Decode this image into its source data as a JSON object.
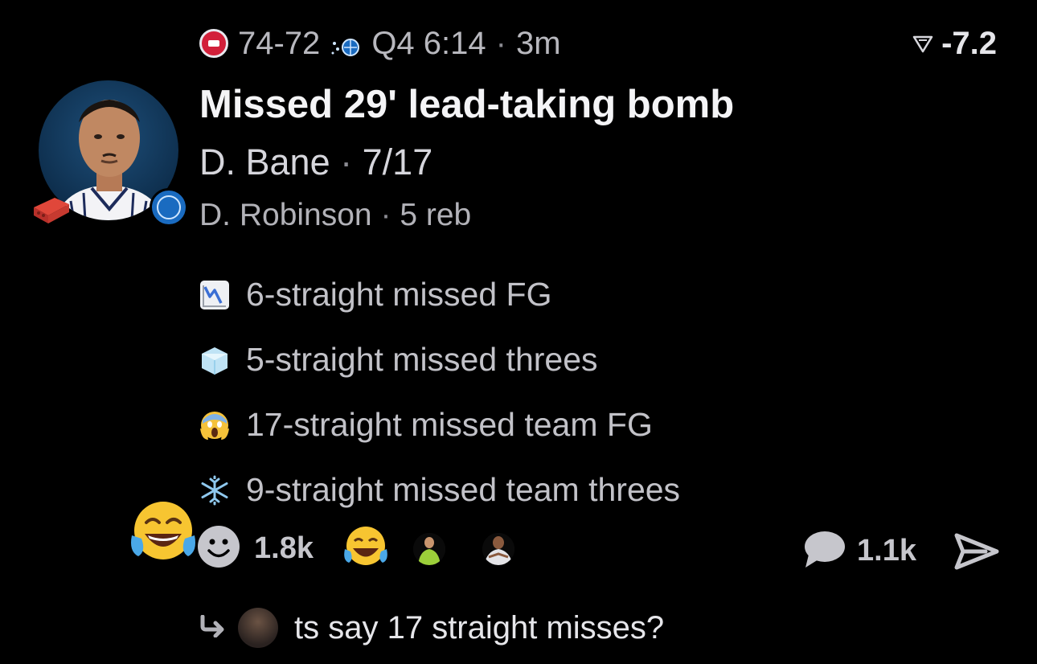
{
  "header": {
    "home_logo_icon": "pistons-logo",
    "score": "74-72",
    "away_logo_icon": "magic-logo",
    "game_clock": "Q4 6:14",
    "separator": "·",
    "age": "3m",
    "line_icon": "triangle-down-icon",
    "line_value": "-7.2"
  },
  "play": {
    "title": "Missed 29' lead-taking bomb",
    "player": "D. Bane",
    "player_stat": "7/17",
    "secondary_player": "D. Robinson",
    "secondary_stat": "5 reb",
    "separator": "·"
  },
  "stats": [
    {
      "icon": "chart-decreasing-icon",
      "text": "6-straight missed FG"
    },
    {
      "icon": "ice-cube-icon",
      "text": "5-straight missed threes"
    },
    {
      "icon": "screaming-face-icon",
      "text": "17-straight missed team FG"
    },
    {
      "icon": "snowflake-icon",
      "text": "9-straight missed team threes"
    }
  ],
  "reactions": {
    "user_reaction_icon": "tears-of-joy-icon",
    "add_reaction_icon": "smiley-add-icon",
    "count": "1.8k",
    "top_reaction_icon": "tears-of-joy-icon"
  },
  "comments": {
    "icon": "speech-bubble-icon",
    "count": "1.1k"
  },
  "share": {
    "icon": "send-icon"
  },
  "reply": {
    "icon": "reply-arrow-icon",
    "text": "ts say 17 straight misses?"
  },
  "colors": {
    "background": "#000000",
    "primary_text": "#f4f4f6",
    "secondary_text": "#b2b2b8",
    "pistons_red": "#d2203a",
    "magic_blue": "#1a6bc0"
  }
}
